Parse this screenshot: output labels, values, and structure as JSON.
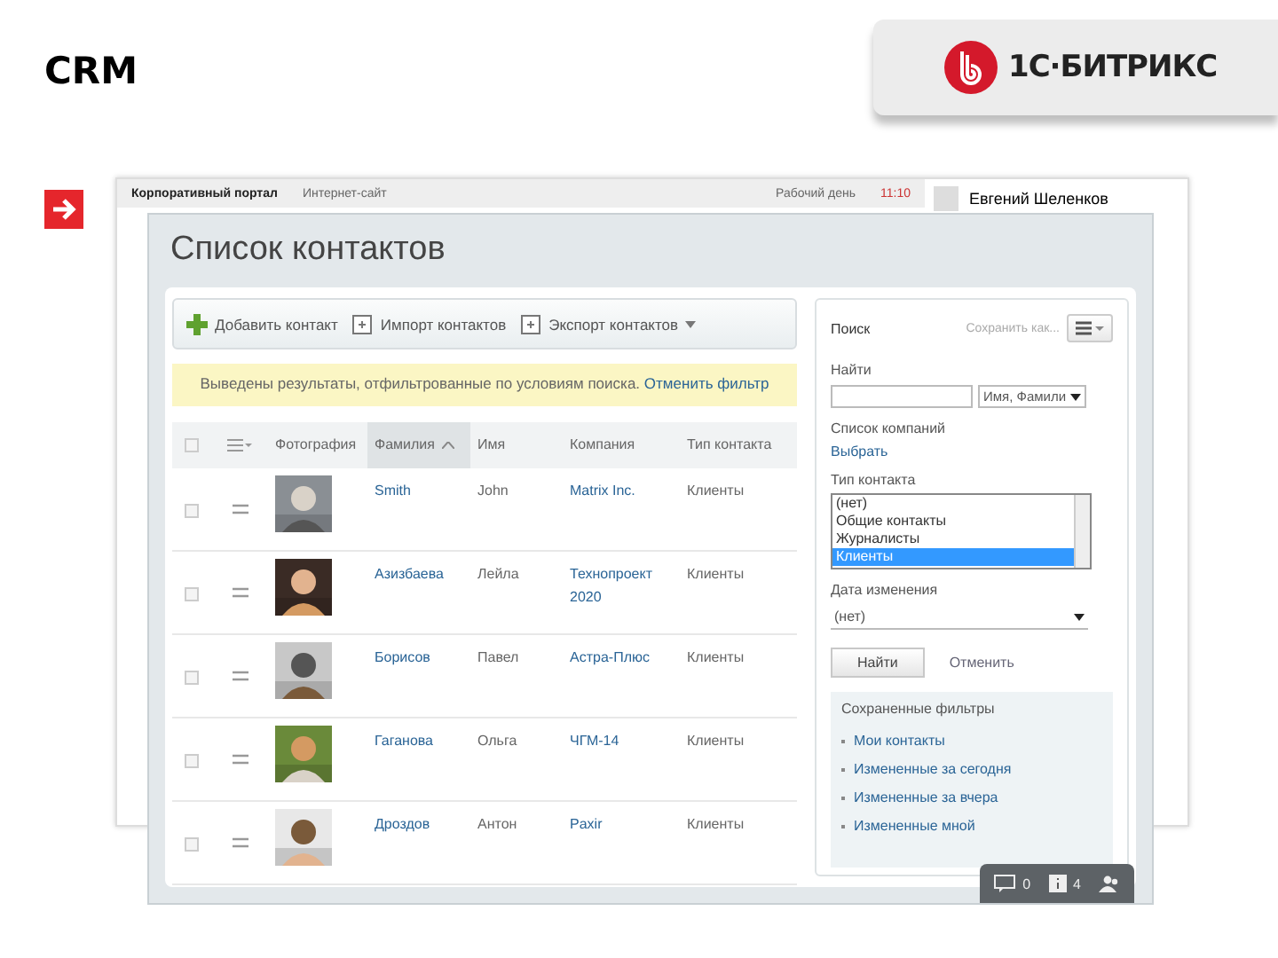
{
  "slide": {
    "title": "CRM",
    "logo": "1С·БИТРИКС"
  },
  "portal": {
    "tabs": [
      "Корпоративный портал",
      "Интернет-сайт"
    ],
    "workday": "Рабочий день",
    "time": "11:10",
    "user": "Евгений Шеленков"
  },
  "dialog": {
    "title": "Список контактов",
    "toolbar": [
      {
        "kind": "add",
        "label": "Добавить контакт"
      },
      {
        "kind": "import",
        "label": "Импорт контактов"
      },
      {
        "kind": "export",
        "label": "Экспорт контактов"
      }
    ],
    "notice": {
      "text": "Выведены результаты, отфильтрованные по условиям поиска.",
      "link": "Отменить фильтр"
    },
    "table": {
      "all_checked": false,
      "columns": [
        {
          "label": "Фотография",
          "selected": false
        },
        {
          "label": "Фамилия",
          "selected": true
        },
        {
          "label": "Имя",
          "selected": false
        },
        {
          "label": "Компания",
          "selected": false
        },
        {
          "label": "Тип контакта",
          "selected": false
        }
      ],
      "rows": [
        {
          "surname": "Smith",
          "name": "John",
          "company": "Matrix Inc.",
          "type": "Клиенты",
          "checked": false
        },
        {
          "surname": "Азизбаева",
          "name": "Лейла",
          "company": "Технопроект 2020",
          "type": "Клиенты",
          "checked": false
        },
        {
          "surname": "Борисов",
          "name": "Павел",
          "company": "Астра-Плюс",
          "type": "Клиенты",
          "checked": false
        },
        {
          "surname": "Гаганова",
          "name": "Ольга",
          "company": "ЧГМ-14",
          "type": "Клиенты",
          "checked": false
        },
        {
          "surname": "Дроздов",
          "name": "Антон",
          "company": "Paxir",
          "type": "Клиенты",
          "checked": false
        }
      ]
    },
    "filter": {
      "title": "Поиск",
      "save": "Сохранить как...",
      "find_label": "Найти",
      "find_by": "Имя, Фамили",
      "companies_label": "Список компаний",
      "companies_link": "Выбрать",
      "type_label": "Тип контакта",
      "type_options": [
        {
          "label": "(нет)",
          "selected": false
        },
        {
          "label": "Общие контакты",
          "selected": false
        },
        {
          "label": "Журналисты",
          "selected": false
        },
        {
          "label": "Клиенты",
          "selected": true
        }
      ],
      "date_label": "Дата изменения",
      "date_value": "(нет)",
      "find_button": "Найти",
      "cancel": "Отменить",
      "saved_title": "Сохраненные фильтры",
      "saved": [
        "Мои контакты",
        "Измененные за сегодня",
        "Измененные за вчера",
        "Измененные мной"
      ]
    },
    "status_bar": [
      {
        "kind": "chat",
        "count": "0"
      },
      {
        "kind": "info",
        "count": "4"
      },
      {
        "kind": "users"
      }
    ]
  }
}
